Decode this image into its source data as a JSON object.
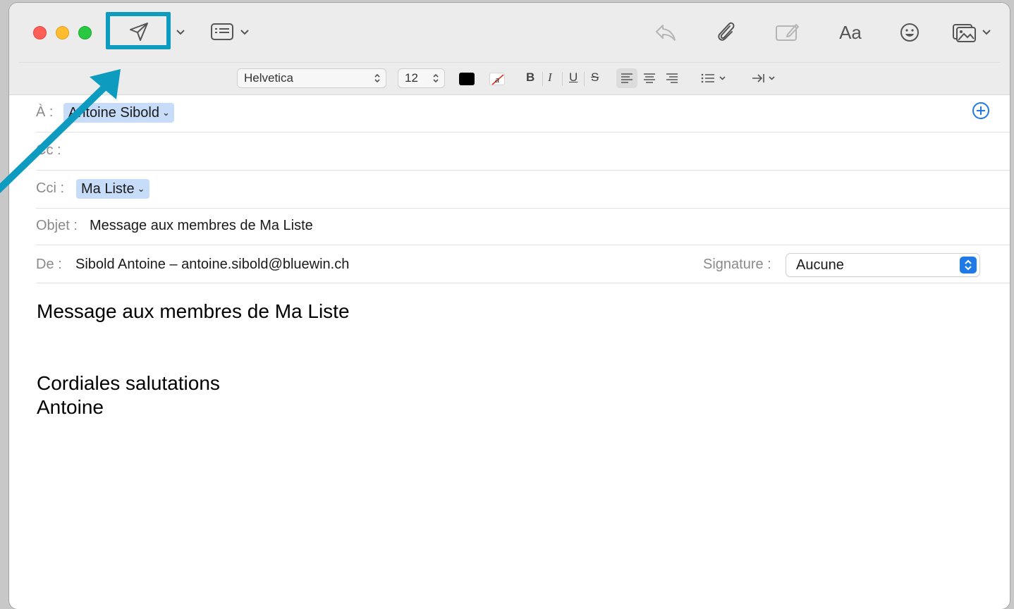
{
  "toolbar": {
    "buttons": [
      {
        "name": "send",
        "icon": "paper-plane-icon"
      },
      {
        "name": "header-fields",
        "icon": "header-fields-icon"
      },
      {
        "name": "reply",
        "icon": "reply-arrow-icon"
      },
      {
        "name": "attach",
        "icon": "paperclip-icon"
      },
      {
        "name": "markup",
        "icon": "markup-icon"
      },
      {
        "name": "format",
        "icon": "format-text-icon",
        "label": "Aa"
      },
      {
        "name": "emoji",
        "icon": "smiley-icon"
      },
      {
        "name": "photo-browser",
        "icon": "photo-icon"
      }
    ]
  },
  "format_bar": {
    "font": "Helvetica",
    "size": "12",
    "text_color": "#000000",
    "bold": "B",
    "italic": "I",
    "underline": "U",
    "strike": "S"
  },
  "fields": {
    "to_label": "À :",
    "to_value": "Antoine Sibold",
    "cc_label": "Cc :",
    "bcc_label": "Cci :",
    "bcc_value": "Ma Liste",
    "subject_label": "Objet :",
    "subject_value": "Message aux membres de Ma Liste",
    "from_label": "De :",
    "from_value": "Sibold Antoine – antoine.sibold@bluewin.ch",
    "signature_label": "Signature :",
    "signature_value": "Aucune"
  },
  "body": {
    "line1": "Message aux membres de Ma Liste",
    "line2": "Cordiales salutations",
    "line3": "Antoine"
  },
  "colors": {
    "highlight": "#0e9bc0",
    "token": "#c6dcf8",
    "accent": "#1f7ae8"
  }
}
